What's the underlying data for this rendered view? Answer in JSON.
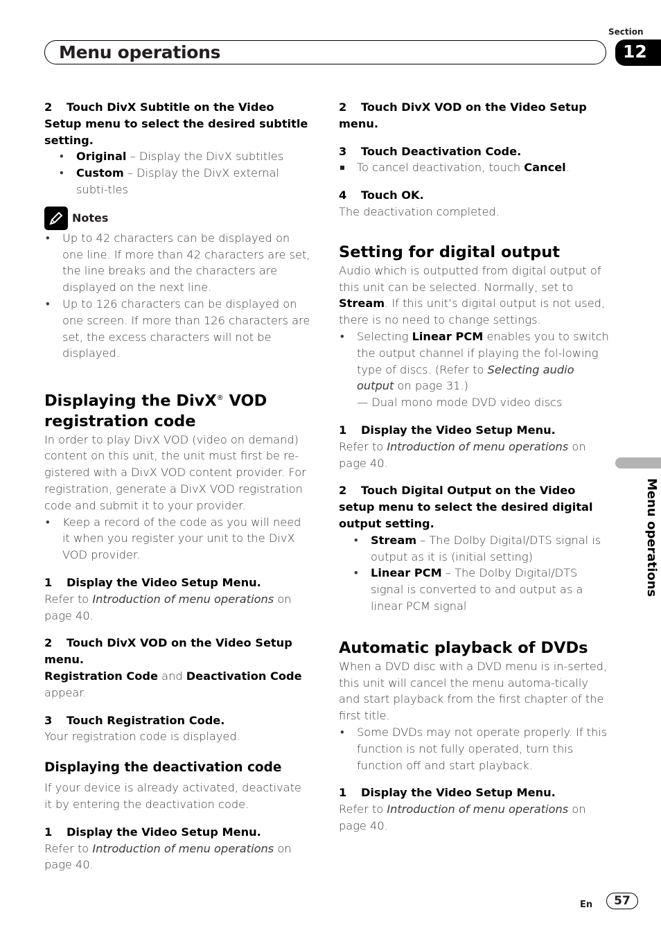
{
  "header": {
    "section_label": "Section",
    "section_number": "12",
    "title": "Menu operations"
  },
  "left": {
    "step2_subtitle": {
      "num": "2",
      "text": "Touch DivX Subtitle on the Video Setup menu to select the desired subtitle setting."
    },
    "subtitle_options": [
      {
        "label": "Original",
        "desc": " – Display the DivX subtitles"
      },
      {
        "label": "Custom",
        "desc": " – Display the DivX external subti-tles"
      }
    ],
    "notes": {
      "label": "Notes",
      "items": [
        "Up to 42 characters can be displayed on one line. If more than 42 characters are set, the line breaks and the characters are displayed on the next line.",
        "Up to 126 characters can be displayed on one screen. If more than 126 characters are set, the excess characters will not be displayed."
      ]
    },
    "reg_heading_a": "Displaying the DivX",
    "reg_heading_mark": "®",
    "reg_heading_b": " VOD registration code",
    "reg_intro": "In order to play DivX VOD (video on demand) content on this unit, the unit must first be re-gistered with a DivX VOD content provider. For registration, generate a DivX VOD registration code and submit it to your provider.",
    "reg_bullet": "Keep a record of the code as you will need it when you register your unit to the DivX VOD provider.",
    "steps": [
      {
        "num": "1",
        "text": "Display the Video Setup Menu."
      },
      {
        "num": "2",
        "text": "Touch DivX VOD on the Video Setup menu."
      },
      {
        "num": "3",
        "text": "Touch Registration Code."
      }
    ],
    "refer_prefix": "Refer to ",
    "refer_link": "Introduction of menu operations",
    "refer_suffix": " on page 40.",
    "reg_code_label": "Registration Code",
    "and": " and ",
    "deact_code_label": "Deactivation Code",
    "appear": " appear.",
    "reg_displayed": "Your registration code is displayed.",
    "deact_heading": "Displaying the deactivation code",
    "deact_intro": "If your device is already activated, deactivate it by entering the deactivation code.",
    "deact_step1": {
      "num": "1",
      "text": "Display the Video Setup Menu."
    }
  },
  "right": {
    "steps_deact": [
      {
        "num": "2",
        "text": "Touch DivX VOD on the Video Setup menu."
      },
      {
        "num": "3",
        "text": "Touch Deactivation Code."
      },
      {
        "num": "4",
        "text": "Touch OK."
      }
    ],
    "cancel_prefix": "To cancel deactivation, touch ",
    "cancel_label": "Cancel",
    "cancel_suffix": ".",
    "deact_done": "The deactivation completed.",
    "digital_heading": "Setting for digital output",
    "digital_intro_a": "Audio which is outputted from digital output of this unit can be selected. Normally, set to ",
    "digital_intro_stream": "Stream",
    "digital_intro_b": ". If this unit’s digital output is not used, there is no need to change settings.",
    "digital_bullet_a": "Selecting ",
    "digital_bullet_lpcm": "Linear PCM",
    "digital_bullet_b": " enables you to switch the output channel if playing the fol-lowing type of discs. (Refer to ",
    "digital_bullet_link": "Selecting audio output",
    "digital_bullet_c": " on page 31.)",
    "digital_dash": "— Dual mono mode DVD video discs",
    "digital_steps": [
      {
        "num": "1",
        "text": "Display the Video Setup Menu."
      },
      {
        "num": "2",
        "text": "Touch Digital Output on the Video setup menu to select the desired digital output setting."
      }
    ],
    "digital_options": [
      {
        "label": "Stream",
        "desc": " – The Dolby Digital/DTS signal is output as it is (initial setting)"
      },
      {
        "label": "Linear PCM",
        "desc": " – The Dolby Digital/DTS signal is converted to and output as a linear PCM signal"
      }
    ],
    "auto_heading": "Automatic playback of DVDs",
    "auto_intro": "When a DVD disc with a DVD menu is in-serted, this unit will cancel the menu automa-tically and start playback from the first chapter of the first title.",
    "auto_bullet": "Some DVDs may not operate properly. If this function is not fully operated, turn this function off and start playback.",
    "auto_step1": {
      "num": "1",
      "text": "Display the Video Setup Menu."
    }
  },
  "side_tab": {
    "label": "Menu operations"
  },
  "footer": {
    "lang": "En",
    "page": "57"
  }
}
